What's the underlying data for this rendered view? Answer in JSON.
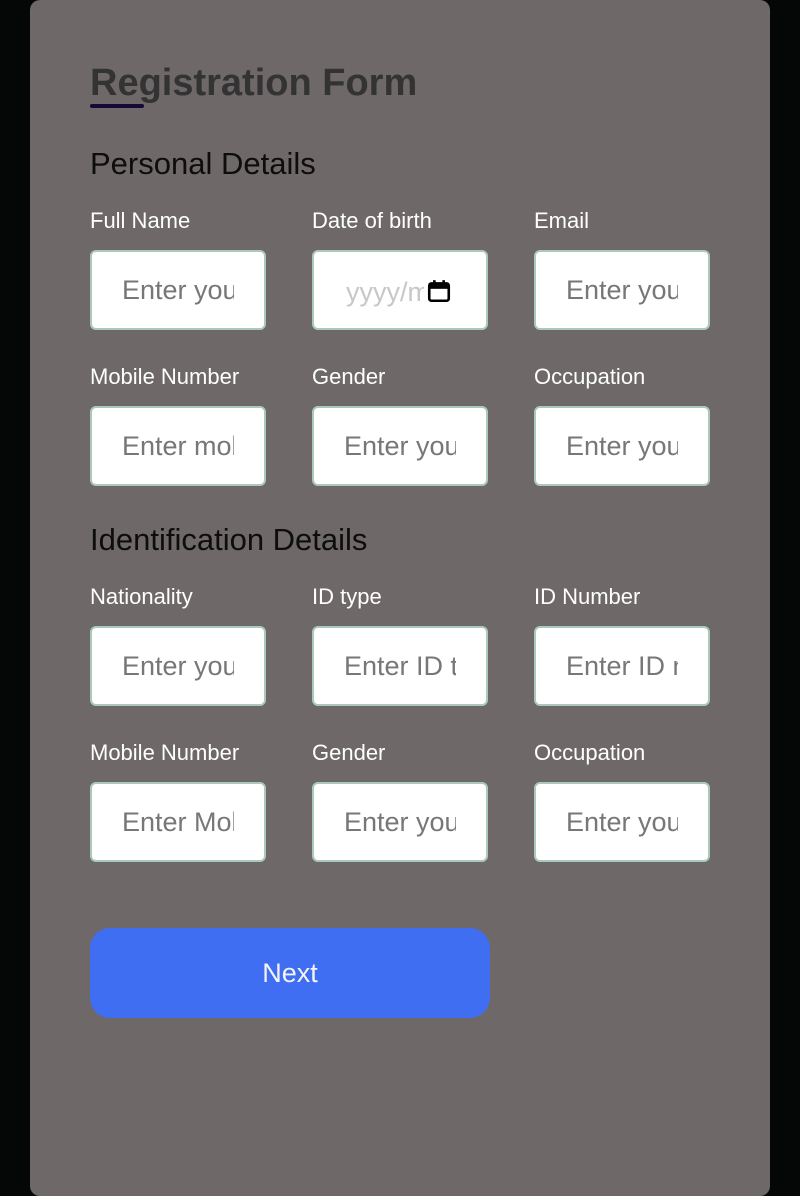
{
  "form": {
    "title": "Registration Form",
    "next_label": "Next"
  },
  "personal": {
    "heading": "Personal Details",
    "full_name": {
      "label": "Full Name",
      "placeholder": "Enter your full name"
    },
    "dob": {
      "label": "Date of birth",
      "placeholder": "yyyy/mm/dd"
    },
    "email": {
      "label": "Email",
      "placeholder": "Enter your email"
    },
    "mobile": {
      "label": "Mobile Number",
      "placeholder": "Enter mobile number"
    },
    "gender": {
      "label": "Gender",
      "placeholder": "Enter your gender"
    },
    "occupation": {
      "label": "Occupation",
      "placeholder": "Enter your occupation"
    }
  },
  "identification": {
    "heading": "Identification Details",
    "nationality": {
      "label": "Nationality",
      "placeholder": "Enter your nationality"
    },
    "id_type": {
      "label": "ID type",
      "placeholder": "Enter ID type"
    },
    "id_number": {
      "label": "ID Number",
      "placeholder": "Enter ID number"
    },
    "mobile": {
      "label": "Mobile Number",
      "placeholder": "Enter Mobile Number"
    },
    "gender": {
      "label": "Gender",
      "placeholder": "Enter your gender"
    },
    "occupation": {
      "label": "Occupation",
      "placeholder": "Enter your occupation"
    }
  },
  "icons": {
    "calendar": "calendar-icon"
  }
}
